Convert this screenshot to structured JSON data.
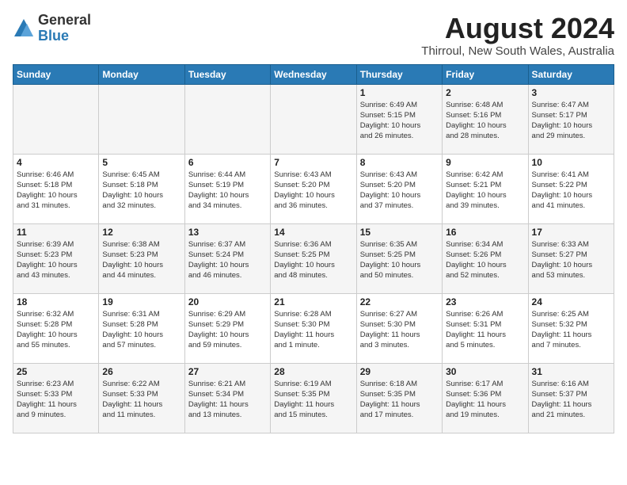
{
  "header": {
    "logo": {
      "general": "General",
      "blue": "Blue"
    },
    "title": "August 2024",
    "subtitle": "Thirroul, New South Wales, Australia"
  },
  "weekdays": [
    "Sunday",
    "Monday",
    "Tuesday",
    "Wednesday",
    "Thursday",
    "Friday",
    "Saturday"
  ],
  "weeks": [
    [
      {
        "day": "",
        "info": ""
      },
      {
        "day": "",
        "info": ""
      },
      {
        "day": "",
        "info": ""
      },
      {
        "day": "",
        "info": ""
      },
      {
        "day": "1",
        "info": "Sunrise: 6:49 AM\nSunset: 5:15 PM\nDaylight: 10 hours\nand 26 minutes."
      },
      {
        "day": "2",
        "info": "Sunrise: 6:48 AM\nSunset: 5:16 PM\nDaylight: 10 hours\nand 28 minutes."
      },
      {
        "day": "3",
        "info": "Sunrise: 6:47 AM\nSunset: 5:17 PM\nDaylight: 10 hours\nand 29 minutes."
      }
    ],
    [
      {
        "day": "4",
        "info": "Sunrise: 6:46 AM\nSunset: 5:18 PM\nDaylight: 10 hours\nand 31 minutes."
      },
      {
        "day": "5",
        "info": "Sunrise: 6:45 AM\nSunset: 5:18 PM\nDaylight: 10 hours\nand 32 minutes."
      },
      {
        "day": "6",
        "info": "Sunrise: 6:44 AM\nSunset: 5:19 PM\nDaylight: 10 hours\nand 34 minutes."
      },
      {
        "day": "7",
        "info": "Sunrise: 6:43 AM\nSunset: 5:20 PM\nDaylight: 10 hours\nand 36 minutes."
      },
      {
        "day": "8",
        "info": "Sunrise: 6:43 AM\nSunset: 5:20 PM\nDaylight: 10 hours\nand 37 minutes."
      },
      {
        "day": "9",
        "info": "Sunrise: 6:42 AM\nSunset: 5:21 PM\nDaylight: 10 hours\nand 39 minutes."
      },
      {
        "day": "10",
        "info": "Sunrise: 6:41 AM\nSunset: 5:22 PM\nDaylight: 10 hours\nand 41 minutes."
      }
    ],
    [
      {
        "day": "11",
        "info": "Sunrise: 6:39 AM\nSunset: 5:23 PM\nDaylight: 10 hours\nand 43 minutes."
      },
      {
        "day": "12",
        "info": "Sunrise: 6:38 AM\nSunset: 5:23 PM\nDaylight: 10 hours\nand 44 minutes."
      },
      {
        "day": "13",
        "info": "Sunrise: 6:37 AM\nSunset: 5:24 PM\nDaylight: 10 hours\nand 46 minutes."
      },
      {
        "day": "14",
        "info": "Sunrise: 6:36 AM\nSunset: 5:25 PM\nDaylight: 10 hours\nand 48 minutes."
      },
      {
        "day": "15",
        "info": "Sunrise: 6:35 AM\nSunset: 5:25 PM\nDaylight: 10 hours\nand 50 minutes."
      },
      {
        "day": "16",
        "info": "Sunrise: 6:34 AM\nSunset: 5:26 PM\nDaylight: 10 hours\nand 52 minutes."
      },
      {
        "day": "17",
        "info": "Sunrise: 6:33 AM\nSunset: 5:27 PM\nDaylight: 10 hours\nand 53 minutes."
      }
    ],
    [
      {
        "day": "18",
        "info": "Sunrise: 6:32 AM\nSunset: 5:28 PM\nDaylight: 10 hours\nand 55 minutes."
      },
      {
        "day": "19",
        "info": "Sunrise: 6:31 AM\nSunset: 5:28 PM\nDaylight: 10 hours\nand 57 minutes."
      },
      {
        "day": "20",
        "info": "Sunrise: 6:29 AM\nSunset: 5:29 PM\nDaylight: 10 hours\nand 59 minutes."
      },
      {
        "day": "21",
        "info": "Sunrise: 6:28 AM\nSunset: 5:30 PM\nDaylight: 11 hours\nand 1 minute."
      },
      {
        "day": "22",
        "info": "Sunrise: 6:27 AM\nSunset: 5:30 PM\nDaylight: 11 hours\nand 3 minutes."
      },
      {
        "day": "23",
        "info": "Sunrise: 6:26 AM\nSunset: 5:31 PM\nDaylight: 11 hours\nand 5 minutes."
      },
      {
        "day": "24",
        "info": "Sunrise: 6:25 AM\nSunset: 5:32 PM\nDaylight: 11 hours\nand 7 minutes."
      }
    ],
    [
      {
        "day": "25",
        "info": "Sunrise: 6:23 AM\nSunset: 5:33 PM\nDaylight: 11 hours\nand 9 minutes."
      },
      {
        "day": "26",
        "info": "Sunrise: 6:22 AM\nSunset: 5:33 PM\nDaylight: 11 hours\nand 11 minutes."
      },
      {
        "day": "27",
        "info": "Sunrise: 6:21 AM\nSunset: 5:34 PM\nDaylight: 11 hours\nand 13 minutes."
      },
      {
        "day": "28",
        "info": "Sunrise: 6:19 AM\nSunset: 5:35 PM\nDaylight: 11 hours\nand 15 minutes."
      },
      {
        "day": "29",
        "info": "Sunrise: 6:18 AM\nSunset: 5:35 PM\nDaylight: 11 hours\nand 17 minutes."
      },
      {
        "day": "30",
        "info": "Sunrise: 6:17 AM\nSunset: 5:36 PM\nDaylight: 11 hours\nand 19 minutes."
      },
      {
        "day": "31",
        "info": "Sunrise: 6:16 AM\nSunset: 5:37 PM\nDaylight: 11 hours\nand 21 minutes."
      }
    ]
  ]
}
